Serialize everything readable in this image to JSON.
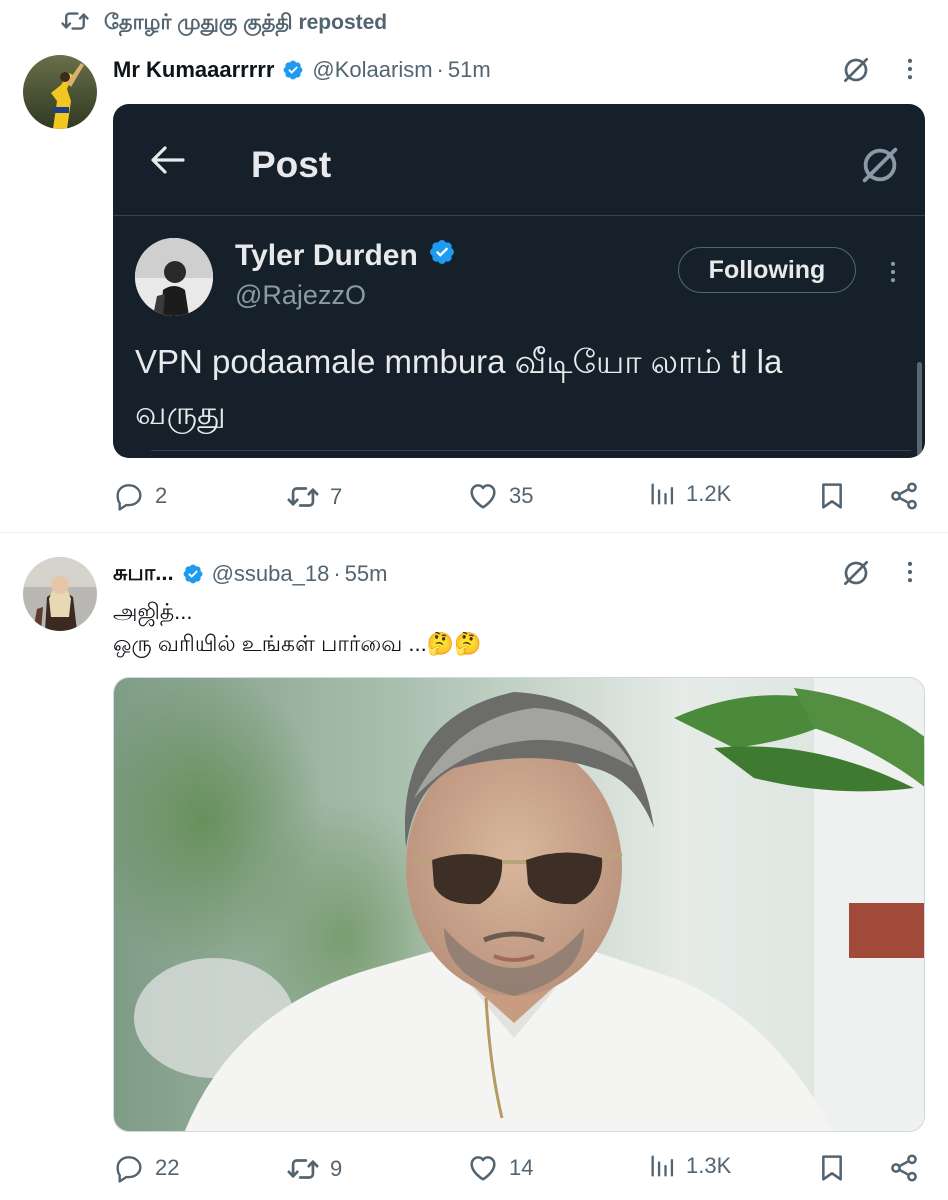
{
  "repost": {
    "user": "தோழர் முதுகு குத்தி",
    "label": "reposted"
  },
  "tweet1": {
    "name": "Mr Kumaaarrrrr",
    "handle": "@Kolaarism",
    "separator": "·",
    "time": "51m",
    "embed": {
      "title": "Post",
      "name": "Tyler Durden",
      "handle": "@RajezzO",
      "follow_label": "Following",
      "text_line1": "VPN podaamale mmbura வீடியோ லாம் tl la",
      "text_line2": "வருது"
    },
    "stats": {
      "replies": "2",
      "reposts": "7",
      "likes": "35",
      "views": "1.2K"
    }
  },
  "tweet2": {
    "name": "சுபா...",
    "handle": "@ssuba_18",
    "separator": "·",
    "time": "55m",
    "text_line1": "அஜித்...",
    "text_line2": "ஒரு வரியில் உங்கள் பார்வை ...🤔🤔",
    "stats": {
      "replies": "22",
      "reposts": "9",
      "likes": "14",
      "views": "1.3K"
    }
  },
  "colors": {
    "verified": "#1d9bf0",
    "dark_bg": "#15202b",
    "muted": "#536471"
  },
  "icons": [
    "repost-icon",
    "verified-badge-icon",
    "grok-icon",
    "more-icon",
    "back-arrow-icon",
    "reply-icon",
    "like-icon",
    "views-icon",
    "bookmark-icon",
    "share-icon"
  ]
}
